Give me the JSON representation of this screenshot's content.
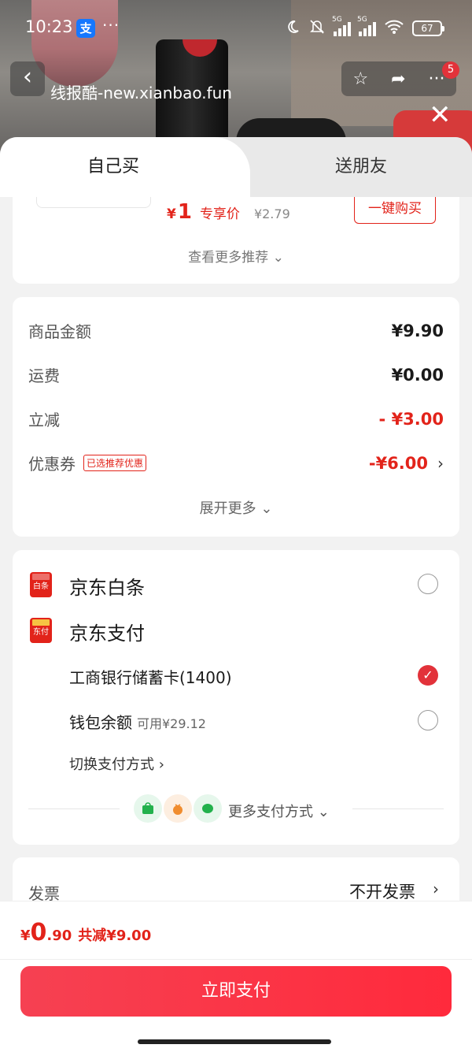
{
  "status_bar": {
    "time": "10:23",
    "alipay_glyph": "支",
    "more_glyph": "···",
    "signal_tag_1": "5G",
    "signal_tag_2": "5G",
    "battery": "67"
  },
  "nav": {
    "back_glyph": "‹",
    "watermark": "线报酷-new.xianbao.fun",
    "star_glyph": "☆",
    "share_glyph": "➦",
    "more_glyph": "···",
    "badge": "5",
    "close_glyph": "✕"
  },
  "tabs": {
    "self": "自己买",
    "friend": "送朋友"
  },
  "recommend": {
    "currency": "¥",
    "price": "1",
    "tag": "专享价",
    "original": "¥2.79",
    "buy_button": "一键购买",
    "see_more": "查看更多推荐 ⌄"
  },
  "summary": {
    "rows": [
      {
        "label": "商品金额",
        "value": "¥9.90"
      },
      {
        "label": "运费",
        "value": "¥0.00"
      },
      {
        "label": "立减",
        "value": "- ¥3.00"
      },
      {
        "label": "优惠券",
        "value": "-¥6.00",
        "tag": "已选推荐优惠"
      }
    ],
    "expand": "展开更多 ⌄",
    "chevron": "›"
  },
  "payment": {
    "baitiao": {
      "label": "京东白条",
      "logo_text": "白条"
    },
    "jdpay": {
      "label": "京东支付",
      "logo_text": "东付"
    },
    "card": {
      "label": "工商银行储蓄卡(1400)",
      "check": "✓"
    },
    "wallet": {
      "label": "钱包余额",
      "available": "可用¥29.12"
    },
    "switch": "切换支付方式 ›",
    "more": "更多支付方式 ⌄"
  },
  "invoice": {
    "label": "发票",
    "value": "不开发票",
    "chevron": "›"
  },
  "bottom": {
    "currency": "¥",
    "int": "0",
    "dec": ".90",
    "saved": "共减¥9.00",
    "pay_button": "立即支付"
  },
  "colors": {
    "accent": "#e2231a",
    "pay_button": "#ff2a3c"
  }
}
